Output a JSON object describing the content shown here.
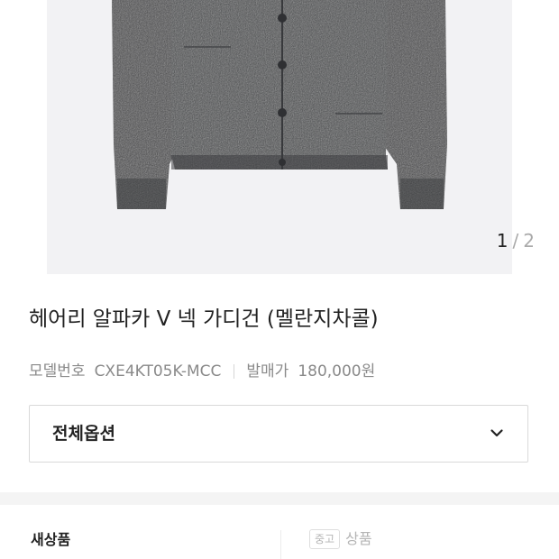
{
  "gallery": {
    "current": "1",
    "separator": "/",
    "total": "2"
  },
  "product": {
    "title": "헤어리 알파카 V 넥 가디건 (멜란지차콜)",
    "model_label": "모델번호",
    "model_number": "CXE4KT05K-MCC",
    "release_label": "발매가",
    "release_price": "180,000원"
  },
  "options": {
    "label": "전체옵션",
    "icon": "chevron-down-icon"
  },
  "condition": {
    "new_label": "새상품",
    "used_badge": "중고",
    "used_label": "상품"
  },
  "colors": {
    "photo_background": "#f2f2f4",
    "knit": "#46474a"
  }
}
